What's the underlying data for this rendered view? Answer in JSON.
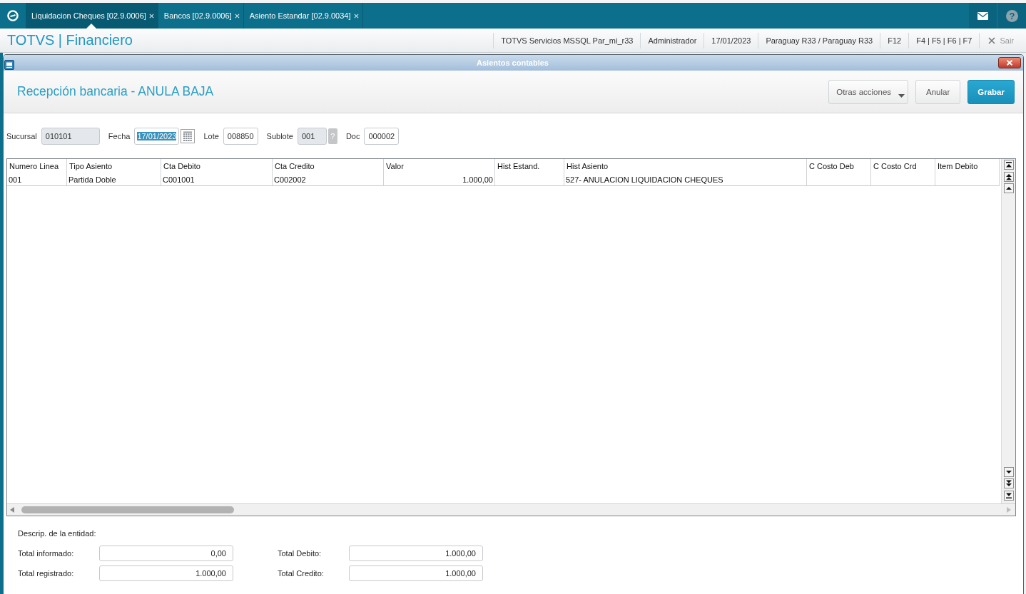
{
  "top_bar": {
    "tabs": [
      {
        "label": "Liquidacion Cheques [02.9.0006]",
        "selected": true
      },
      {
        "label": "Bancos [02.9.0006]",
        "selected": false
      },
      {
        "label": "Asiento Estandar [02.9.0034]",
        "selected": false
      }
    ],
    "help": "?"
  },
  "header_bar": {
    "title": "TOTVS | Financiero",
    "info": [
      "TOTVS Servicios MSSQL Par_mi_r33",
      "Administrador",
      "17/01/2023",
      "Paraguay R33 / Paraguay R33",
      "F12",
      "F4 | F5 | F6 | F7"
    ],
    "exit": "Sair"
  },
  "dialog": {
    "title": "Asientos contables",
    "heading": "Recepción bancaria - ANULA BAJA",
    "buttons": [
      {
        "label": "Otras acciones",
        "kind": "menu"
      },
      {
        "label": "Anular",
        "kind": "secondary"
      },
      {
        "label": "Grabar",
        "kind": "primary"
      }
    ],
    "fields": [
      {
        "label": "Sucursal",
        "value": "010101",
        "kind": "text",
        "disabled": true,
        "focused": false
      },
      {
        "label": "Fecha",
        "value": "17/01/2023",
        "kind": "date",
        "disabled": false,
        "focused": true
      },
      {
        "label": "Lote",
        "value": "008850",
        "kind": "text",
        "disabled": false,
        "focused": false
      },
      {
        "label": "Sublote",
        "value": "001",
        "kind": "lookup",
        "lookup_label": "?",
        "disabled": true,
        "focused": false
      },
      {
        "label": "Doc",
        "value": "000002",
        "kind": "text",
        "disabled": false,
        "focused": false
      }
    ],
    "grid": {
      "columns": [
        {
          "label": "Numero Linea",
          "kind": "text"
        },
        {
          "label": "Tipo Asiento",
          "kind": "text"
        },
        {
          "label": "Cta Debito",
          "kind": "text"
        },
        {
          "label": "Cta Credito",
          "kind": "text"
        },
        {
          "label": "Valor",
          "kind": "number"
        },
        {
          "label": "Hist Estand.",
          "kind": "text"
        },
        {
          "label": "Hist Asiento",
          "kind": "text"
        },
        {
          "label": "C Costo Deb",
          "kind": "text"
        },
        {
          "label": "C Costo Crd",
          "kind": "text"
        },
        {
          "label": "Item Debito",
          "kind": "text"
        }
      ],
      "rows": [
        {
          "cells": [
            "001",
            "Partida Doble",
            "C001001",
            "C002002",
            "1.000,00",
            null,
            "527- ANULACION LIQUIDACION CHEQUES",
            null,
            null,
            null
          ]
        }
      ]
    },
    "entity_description": "Descrip. de la entidad:",
    "totals": [
      {
        "label": "Total informado:",
        "value": "0,00"
      },
      {
        "label": "Total Debito:",
        "value": "1.000,00"
      },
      {
        "label": "Total registrado:",
        "value": "1.000,00"
      },
      {
        "label": "Total Credito:",
        "value": "1.000,00"
      }
    ]
  }
}
